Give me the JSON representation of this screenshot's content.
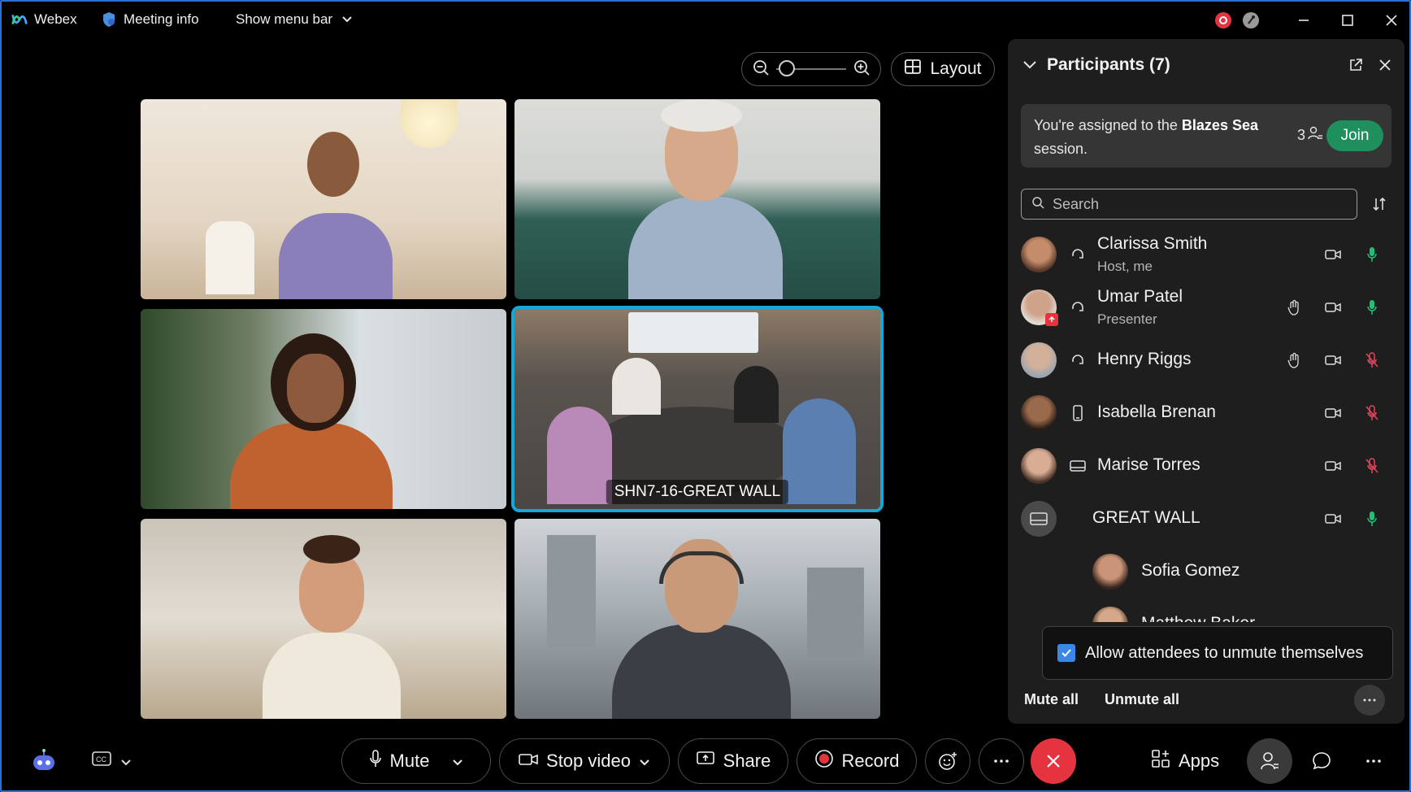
{
  "titlebar": {
    "app_name": "Webex",
    "meeting_info": "Meeting info",
    "show_menu_bar": "Show menu bar"
  },
  "view": {
    "layout_label": "Layout",
    "zoom_level": 0.05
  },
  "video_tiles": [
    {
      "label": ""
    },
    {
      "label": ""
    },
    {
      "label": ""
    },
    {
      "label": "SHN7-16-GREAT WALL"
    },
    {
      "label": ""
    },
    {
      "label": ""
    }
  ],
  "participants_panel": {
    "title": "Participants (7)",
    "session_prefix": "You're assigned to the ",
    "session_name": "Blazes Sea",
    "session_suffix": " session.",
    "session_count": "3",
    "join_label": "Join",
    "search_placeholder": "Search",
    "participants": [
      {
        "name": "Clarissa Smith",
        "role": "Host, me"
      },
      {
        "name": "Umar Patel",
        "role": "Presenter"
      },
      {
        "name": "Henry Riggs",
        "role": ""
      },
      {
        "name": "Isabella Brenan",
        "role": ""
      },
      {
        "name": "Marise Torres",
        "role": ""
      },
      {
        "name": "GREAT WALL",
        "role": ""
      },
      {
        "name": "Sofia Gomez",
        "role": ""
      },
      {
        "name": "Matthew Baker",
        "role": ""
      }
    ],
    "allow_unmute_label": "Allow attendees to unmute themselves",
    "mute_all_label": "Mute all",
    "unmute_all_label": "Unmute all"
  },
  "toolbar": {
    "mute_label": "Mute",
    "stop_video_label": "Stop video",
    "share_label": "Share",
    "record_label": "Record",
    "apps_label": "Apps"
  },
  "colors": {
    "accent_blue": "#17a7d6",
    "join_green": "#1f8f5d",
    "mic_on_green": "#1fbf78",
    "mic_off_red": "#e3475c",
    "end_call_red": "#e5343f",
    "record_red": "#e5343f"
  }
}
